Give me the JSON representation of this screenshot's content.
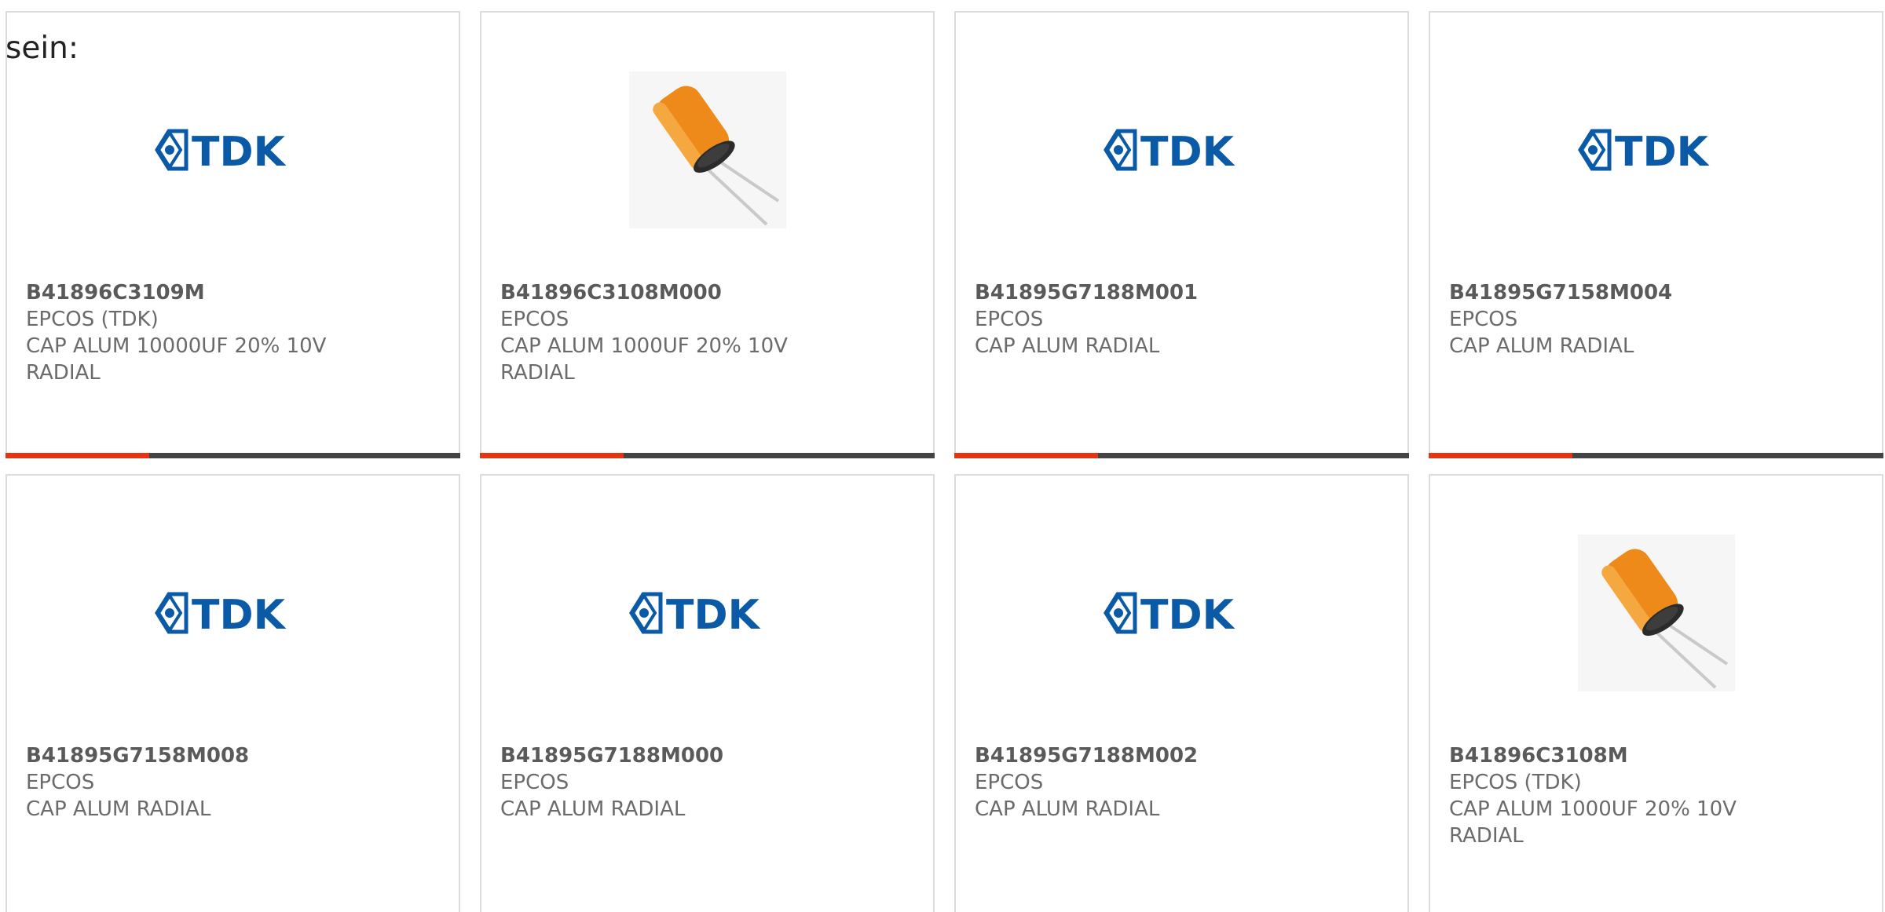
{
  "intro": {
    "text": "sein:"
  },
  "logo": {
    "text": "TDK",
    "color": "#0a5aa8"
  },
  "colors": {
    "accent": "#e63312",
    "bar": "#444444",
    "text": "#6b6b6b"
  },
  "cards": [
    {
      "part_number": "B41896C3109M",
      "manufacturer": "EPCOS (TDK)",
      "description": "CAP ALUM 10000UF 20% 10V RADIAL",
      "image": "tdk-logo"
    },
    {
      "part_number": "B41896C3108M000",
      "manufacturer": "EPCOS",
      "description": "CAP ALUM 1000UF 20% 10V RADIAL",
      "image": "capacitor-photo"
    },
    {
      "part_number": "B41895G7188M001",
      "manufacturer": "EPCOS",
      "description": "CAP ALUM RADIAL",
      "image": "tdk-logo"
    },
    {
      "part_number": "B41895G7158M004",
      "manufacturer": "EPCOS",
      "description": "CAP ALUM RADIAL",
      "image": "tdk-logo"
    },
    {
      "part_number": "B41895G7158M008",
      "manufacturer": "EPCOS",
      "description": "CAP ALUM RADIAL",
      "image": "tdk-logo"
    },
    {
      "part_number": "B41895G7188M000",
      "manufacturer": "EPCOS",
      "description": "CAP ALUM RADIAL",
      "image": "tdk-logo"
    },
    {
      "part_number": "B41895G7188M002",
      "manufacturer": "EPCOS",
      "description": "CAP ALUM RADIAL",
      "image": "tdk-logo"
    },
    {
      "part_number": "B41896C3108M",
      "manufacturer": "EPCOS (TDK)",
      "description": "CAP ALUM 1000UF 20% 10V RADIAL",
      "image": "capacitor-photo"
    }
  ]
}
